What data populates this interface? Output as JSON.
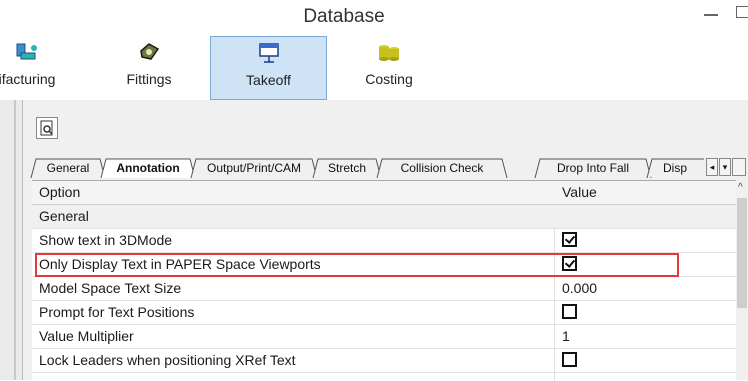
{
  "window": {
    "title": "Database"
  },
  "ribbon": {
    "buttons": [
      {
        "label": "ifacturing",
        "icon": "manufacturing-icon"
      },
      {
        "label": "Fittings",
        "icon": "fittings-icon"
      },
      {
        "label": "Takeoff",
        "icon": "takeoff-icon",
        "selected": true
      },
      {
        "label": "Costing",
        "icon": "costing-icon"
      }
    ]
  },
  "toolbar": {
    "preview_icon": "print-preview-icon"
  },
  "tabs": [
    {
      "label": "General"
    },
    {
      "label": "Annotation",
      "active": true
    },
    {
      "label": "Output/Print/CAM"
    },
    {
      "label": "Stretch"
    },
    {
      "label": "Collision Check"
    },
    {
      "label": "Drop Into Fall"
    },
    {
      "label": "Disp"
    }
  ],
  "grid": {
    "headers": {
      "option": "Option",
      "value": "Value"
    },
    "group": "General",
    "rows": [
      {
        "option": "Show text in 3DMode",
        "value_type": "checkbox",
        "checked": true
      },
      {
        "option": "Only Display Text in PAPER Space Viewports",
        "value_type": "checkbox",
        "checked": true,
        "highlighted": true
      },
      {
        "option": "Model Space Text Size",
        "value_type": "text",
        "value": "0.000"
      },
      {
        "option": "Prompt for Text Positions",
        "value_type": "checkbox",
        "checked": false
      },
      {
        "option": "Value Multiplier",
        "value_type": "text",
        "value": "1"
      },
      {
        "option": "Lock Leaders when positioning XRef Text",
        "value_type": "checkbox",
        "checked": false
      }
    ]
  },
  "colors": {
    "accent_selected": "#cfe3f7",
    "highlight_border": "#e03a3a"
  }
}
